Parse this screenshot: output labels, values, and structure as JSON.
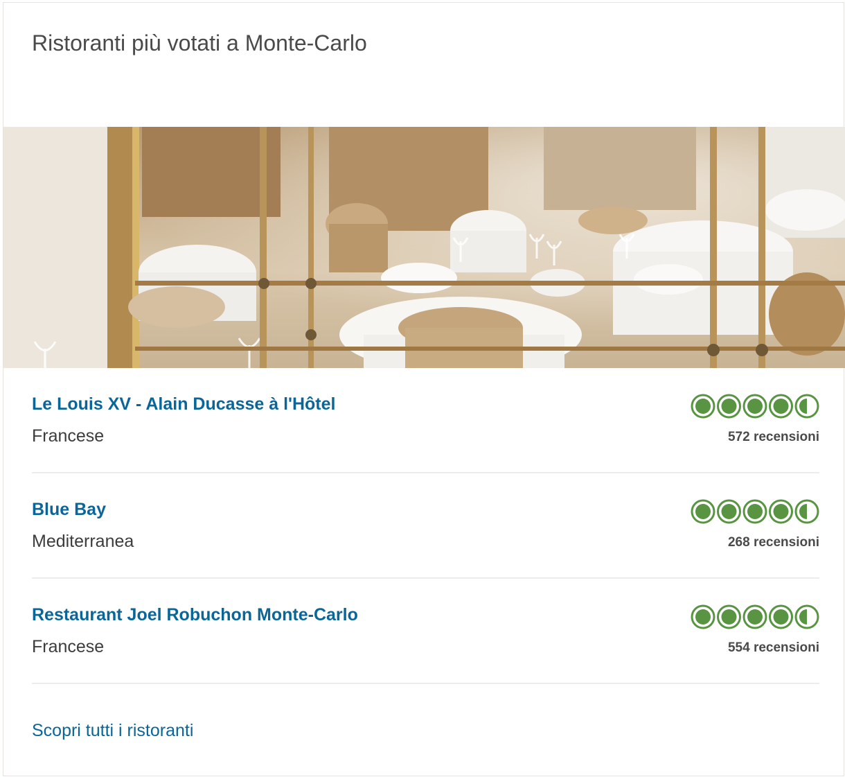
{
  "widget": {
    "title": "Ristoranti più votati a Monte-Carlo",
    "see_all_label": "Scopri tutti i ristoranti",
    "accent_color": "#0a6699",
    "rating_color": "#589442"
  },
  "hero_image": {
    "subject": "restaurant-dining-room-photo"
  },
  "restaurants": [
    {
      "name": "Le Louis XV - Alain Ducasse à l'Hôtel",
      "cuisine": "Francese",
      "rating": 4.5,
      "reviews": "572 recensioni"
    },
    {
      "name": "Blue Bay",
      "cuisine": "Mediterranea",
      "rating": 4.5,
      "reviews": "268 recensioni"
    },
    {
      "name": "Restaurant Joel Robuchon Monte-Carlo",
      "cuisine": "Francese",
      "rating": 4.5,
      "reviews": "554 recensioni"
    }
  ]
}
